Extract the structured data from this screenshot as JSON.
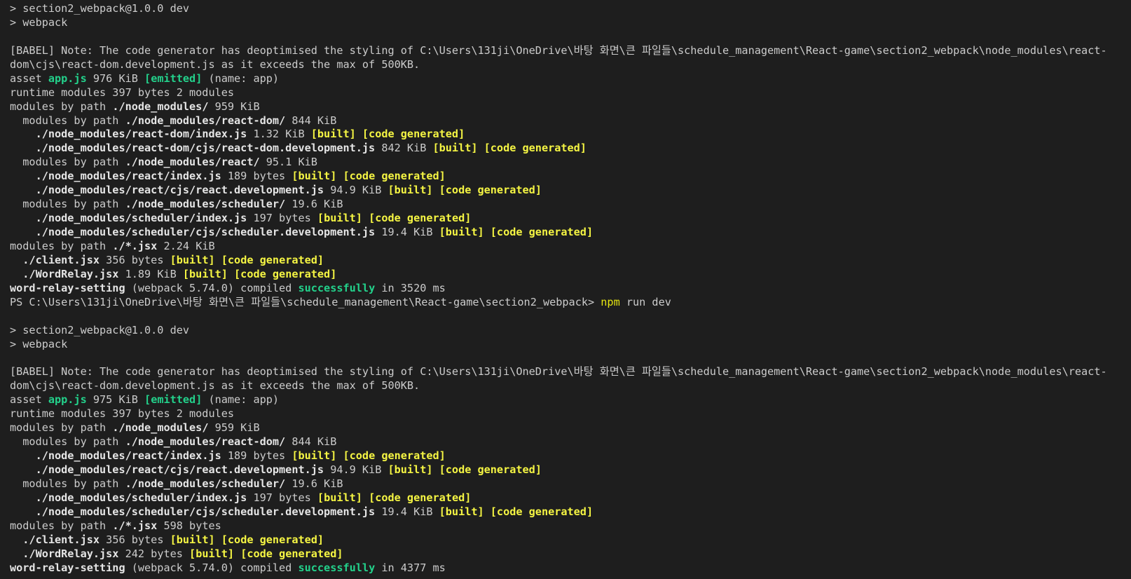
{
  "terminal": {
    "lines": [
      [
        {
          "t": "> section2_webpack@1.0.0 dev"
        }
      ],
      [
        {
          "t": "> webpack"
        }
      ],
      [
        {
          "t": ""
        }
      ],
      [
        {
          "t": "[BABEL] Note: The code generator has deoptimised the styling of C:\\Users\\131ji\\OneDrive\\바탕 화면\\큰 파일들\\schedule_management\\React-game\\section2_webpack\\node_modules\\react-"
        }
      ],
      [
        {
          "t": "dom\\cjs\\react-dom.development.js as it exceeds the max of 500KB."
        }
      ],
      [
        {
          "t": "asset "
        },
        {
          "t": "app.js",
          "c": "gb"
        },
        {
          "t": " 976 KiB "
        },
        {
          "t": "[emitted]",
          "c": "gb"
        },
        {
          "t": " (name: app)"
        }
      ],
      [
        {
          "t": "runtime modules 397 bytes 2 modules"
        }
      ],
      [
        {
          "t": "modules by path "
        },
        {
          "t": "./node_modules/",
          "c": "b"
        },
        {
          "t": " 959 KiB"
        }
      ],
      [
        {
          "t": "  modules by path "
        },
        {
          "t": "./node_modules/react-dom/",
          "c": "b"
        },
        {
          "t": " 844 KiB"
        }
      ],
      [
        {
          "t": "    "
        },
        {
          "t": "./node_modules/react-dom/index.js",
          "c": "b"
        },
        {
          "t": " 1.32 KiB "
        },
        {
          "t": "[built] [code generated]",
          "c": "yb"
        }
      ],
      [
        {
          "t": "    "
        },
        {
          "t": "./node_modules/react-dom/cjs/react-dom.development.js",
          "c": "b"
        },
        {
          "t": " 842 KiB "
        },
        {
          "t": "[built] [code generated]",
          "c": "yb"
        }
      ],
      [
        {
          "t": "  modules by path "
        },
        {
          "t": "./node_modules/react/",
          "c": "b"
        },
        {
          "t": " 95.1 KiB"
        }
      ],
      [
        {
          "t": "    "
        },
        {
          "t": "./node_modules/react/index.js",
          "c": "b"
        },
        {
          "t": " 189 bytes "
        },
        {
          "t": "[built] [code generated]",
          "c": "yb"
        }
      ],
      [
        {
          "t": "    "
        },
        {
          "t": "./node_modules/react/cjs/react.development.js",
          "c": "b"
        },
        {
          "t": " 94.9 KiB "
        },
        {
          "t": "[built] [code generated]",
          "c": "yb"
        }
      ],
      [
        {
          "t": "  modules by path "
        },
        {
          "t": "./node_modules/scheduler/",
          "c": "b"
        },
        {
          "t": " 19.6 KiB"
        }
      ],
      [
        {
          "t": "    "
        },
        {
          "t": "./node_modules/scheduler/index.js",
          "c": "b"
        },
        {
          "t": " 197 bytes "
        },
        {
          "t": "[built] [code generated]",
          "c": "yb"
        }
      ],
      [
        {
          "t": "    "
        },
        {
          "t": "./node_modules/scheduler/cjs/scheduler.development.js",
          "c": "b"
        },
        {
          "t": " 19.4 KiB "
        },
        {
          "t": "[built] [code generated]",
          "c": "yb"
        }
      ],
      [
        {
          "t": "modules by path "
        },
        {
          "t": "./*.jsx",
          "c": "b"
        },
        {
          "t": " 2.24 KiB"
        }
      ],
      [
        {
          "t": "  "
        },
        {
          "t": "./client.jsx",
          "c": "b"
        },
        {
          "t": " 356 bytes "
        },
        {
          "t": "[built] [code generated]",
          "c": "yb"
        }
      ],
      [
        {
          "t": "  "
        },
        {
          "t": "./WordRelay.jsx",
          "c": "b"
        },
        {
          "t": " 1.89 KiB "
        },
        {
          "t": "[built] [code generated]",
          "c": "yb"
        }
      ],
      [
        {
          "t": "word-relay-setting",
          "c": "b"
        },
        {
          "t": " (webpack 5.74.0) compiled "
        },
        {
          "t": "successfully",
          "c": "gb"
        },
        {
          "t": " in 3520 ms"
        }
      ],
      [
        {
          "t": "PS C:\\Users\\131ji\\OneDrive\\바탕 화면\\큰 파일들\\schedule_management\\React-game\\section2_webpack> "
        },
        {
          "t": "npm",
          "c": "y"
        },
        {
          "t": " run dev"
        }
      ],
      [
        {
          "t": ""
        }
      ],
      [
        {
          "t": "> section2_webpack@1.0.0 dev"
        }
      ],
      [
        {
          "t": "> webpack"
        }
      ],
      [
        {
          "t": ""
        }
      ],
      [
        {
          "t": "[BABEL] Note: The code generator has deoptimised the styling of C:\\Users\\131ji\\OneDrive\\바탕 화면\\큰 파일들\\schedule_management\\React-game\\section2_webpack\\node_modules\\react-"
        }
      ],
      [
        {
          "t": "dom\\cjs\\react-dom.development.js as it exceeds the max of 500KB."
        }
      ],
      [
        {
          "t": "asset "
        },
        {
          "t": "app.js",
          "c": "gb"
        },
        {
          "t": " 975 KiB "
        },
        {
          "t": "[emitted]",
          "c": "gb"
        },
        {
          "t": " (name: app)"
        }
      ],
      [
        {
          "t": "runtime modules 397 bytes 2 modules"
        }
      ],
      [
        {
          "t": "modules by path "
        },
        {
          "t": "./node_modules/",
          "c": "b"
        },
        {
          "t": " 959 KiB"
        }
      ],
      [
        {
          "t": "  modules by path "
        },
        {
          "t": "./node_modules/react-dom/",
          "c": "b"
        },
        {
          "t": " 844 KiB"
        }
      ],
      [
        {
          "t": "    "
        },
        {
          "t": "./node_modules/react/index.js",
          "c": "b"
        },
        {
          "t": " 189 bytes "
        },
        {
          "t": "[built] [code generated]",
          "c": "yb"
        }
      ],
      [
        {
          "t": "    "
        },
        {
          "t": "./node_modules/react/cjs/react.development.js",
          "c": "b"
        },
        {
          "t": " 94.9 KiB "
        },
        {
          "t": "[built] [code generated]",
          "c": "yb"
        }
      ],
      [
        {
          "t": "  modules by path "
        },
        {
          "t": "./node_modules/scheduler/",
          "c": "b"
        },
        {
          "t": " 19.6 KiB"
        }
      ],
      [
        {
          "t": "    "
        },
        {
          "t": "./node_modules/scheduler/index.js",
          "c": "b"
        },
        {
          "t": " 197 bytes "
        },
        {
          "t": "[built] [code generated]",
          "c": "yb"
        }
      ],
      [
        {
          "t": "    "
        },
        {
          "t": "./node_modules/scheduler/cjs/scheduler.development.js",
          "c": "b"
        },
        {
          "t": " 19.4 KiB "
        },
        {
          "t": "[built] [code generated]",
          "c": "yb"
        }
      ],
      [
        {
          "t": "modules by path "
        },
        {
          "t": "./*.jsx",
          "c": "b"
        },
        {
          "t": " 598 bytes"
        }
      ],
      [
        {
          "t": "  "
        },
        {
          "t": "./client.jsx",
          "c": "b"
        },
        {
          "t": " 356 bytes "
        },
        {
          "t": "[built] [code generated]",
          "c": "yb"
        }
      ],
      [
        {
          "t": "  "
        },
        {
          "t": "./WordRelay.jsx",
          "c": "b"
        },
        {
          "t": " 242 bytes "
        },
        {
          "t": "[built] [code generated]",
          "c": "yb"
        }
      ],
      [
        {
          "t": "word-relay-setting",
          "c": "b"
        },
        {
          "t": " (webpack 5.74.0) compiled "
        },
        {
          "t": "successfully",
          "c": "gb"
        },
        {
          "t": " in 4377 ms"
        }
      ]
    ]
  }
}
